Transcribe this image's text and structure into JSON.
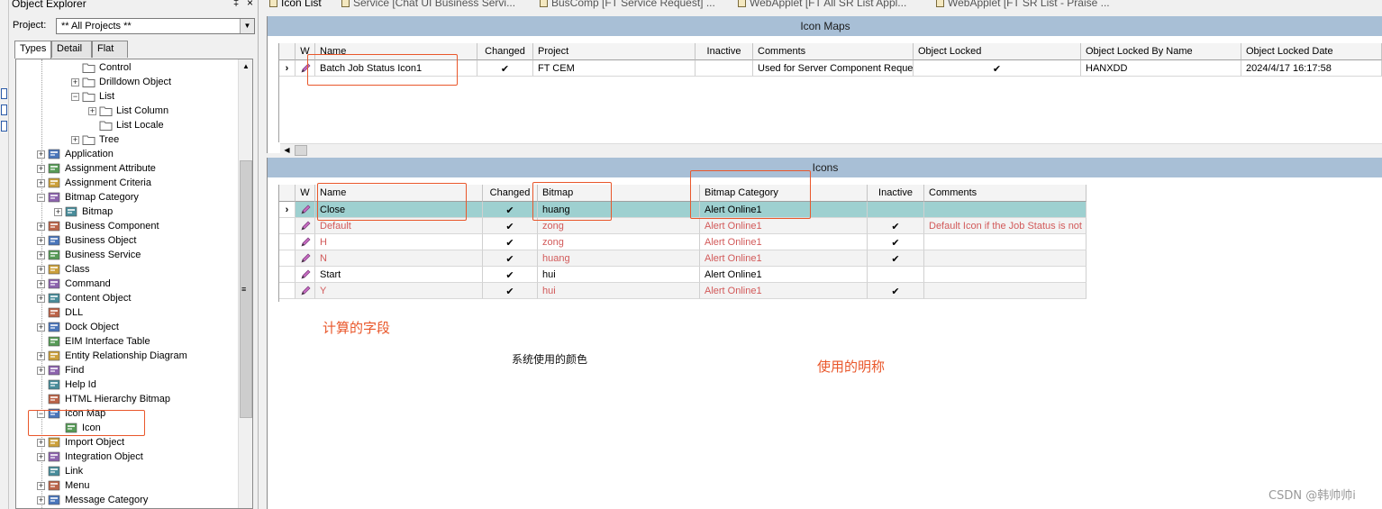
{
  "explorer": {
    "title": "Object Explorer",
    "pin": "‡",
    "close": "×",
    "project_label": "Project:",
    "project_value": "** All Projects **",
    "tabs": [
      "Types",
      "Detail",
      "Flat"
    ],
    "tree": [
      {
        "label": "Control",
        "icon": "folder-icon"
      },
      {
        "label": "Drilldown Object",
        "icon": "folder-icon"
      },
      {
        "label": "List",
        "icon": "folder-icon"
      },
      {
        "label": "List Column",
        "icon": "folder-icon"
      },
      {
        "label": "List Locale",
        "icon": "folder-icon"
      },
      {
        "label": "Tree",
        "icon": "folder-icon"
      },
      {
        "label": "Application",
        "icon": "application-icon"
      },
      {
        "label": "Assignment Attribute",
        "icon": "assignment-attribute-icon"
      },
      {
        "label": "Assignment Criteria",
        "icon": "assignment-criteria-icon"
      },
      {
        "label": "Bitmap Category",
        "icon": "bitmap-category-icon"
      },
      {
        "label": "Bitmap",
        "icon": "bitmap-icon"
      },
      {
        "label": "Business Component",
        "icon": "business-component-icon"
      },
      {
        "label": "Business Object",
        "icon": "business-object-icon"
      },
      {
        "label": "Business Service",
        "icon": "business-service-icon"
      },
      {
        "label": "Class",
        "icon": "class-icon"
      },
      {
        "label": "Command",
        "icon": "command-icon"
      },
      {
        "label": "Content Object",
        "icon": "content-object-icon"
      },
      {
        "label": "DLL",
        "icon": "dll-icon"
      },
      {
        "label": "Dock Object",
        "icon": "dock-object-icon"
      },
      {
        "label": "EIM Interface Table",
        "icon": "eim-table-icon"
      },
      {
        "label": "Entity Relationship Diagram",
        "icon": "erd-icon"
      },
      {
        "label": "Find",
        "icon": "find-icon"
      },
      {
        "label": "Help Id",
        "icon": "help-id-icon"
      },
      {
        "label": "HTML Hierarchy Bitmap",
        "icon": "hierarchy-bitmap-icon"
      },
      {
        "label": "Icon Map",
        "icon": "icon-map-icon"
      },
      {
        "label": "Icon",
        "icon": "icon-grid-icon"
      },
      {
        "label": "Import Object",
        "icon": "import-object-icon"
      },
      {
        "label": "Integration Object",
        "icon": "integration-object-icon"
      },
      {
        "label": "Link",
        "icon": "link-icon"
      },
      {
        "label": "Menu",
        "icon": "menu-icon"
      },
      {
        "label": "Message Category",
        "icon": "message-category-icon"
      }
    ]
  },
  "doc_tabs": [
    "Icon List",
    "Service [Chat UI Business Servi...",
    "BusComp [FT Service Request] ...",
    "WebApplet [FT All SR List Appl...",
    "WebApplet [FT SR List - Praise ..."
  ],
  "icon_maps": {
    "title": "Icon Maps",
    "columns": [
      "W",
      "Name",
      "Changed",
      "Project",
      "Inactive",
      "Comments",
      "Object Locked",
      "Object Locked By Name",
      "Object Locked Date"
    ],
    "rows": [
      {
        "name": "Batch Job Status Icon1",
        "changed": "✔",
        "project": "FT CEM",
        "inactive": "",
        "comments": "Used for Server Component Reques",
        "object_locked": "✔",
        "locked_by": "HANXDD",
        "locked_date": "2024/4/17 16:17:58"
      }
    ]
  },
  "icons": {
    "title": "Icons",
    "columns": [
      "W",
      "Name",
      "Changed",
      "Bitmap",
      "Bitmap Category",
      "Inactive",
      "Comments"
    ],
    "rows": [
      {
        "name": "Close",
        "changed": "✔",
        "bitmap": "huang",
        "category": "Alert Online1",
        "inactive": "",
        "comments": ""
      },
      {
        "name": "Default",
        "changed": "✔",
        "bitmap": "zong",
        "category": "Alert Online1",
        "inactive": "✔",
        "comments": "Default Icon if the Job Status is not"
      },
      {
        "name": "H",
        "changed": "✔",
        "bitmap": "zong",
        "category": "Alert Online1",
        "inactive": "✔",
        "comments": ""
      },
      {
        "name": "N",
        "changed": "✔",
        "bitmap": "huang",
        "category": "Alert Online1",
        "inactive": "✔",
        "comments": ""
      },
      {
        "name": "Start",
        "changed": "✔",
        "bitmap": "hui",
        "category": "Alert Online1",
        "inactive": "",
        "comments": ""
      },
      {
        "name": "Y",
        "changed": "✔",
        "bitmap": "hui",
        "category": "Alert Online1",
        "inactive": "✔",
        "comments": ""
      }
    ]
  },
  "annotations": {
    "computed_field": "计算的字段",
    "system_color": "系统使用的颜色",
    "used_name": "使用的明称"
  },
  "watermark": "CSDN @韩帅帅i",
  "colors": {
    "panel_header": "#a8bfd6",
    "selected_row": "#9ed0d0",
    "inactive_text": "#d25a5a",
    "annotation": "#e9572b"
  }
}
